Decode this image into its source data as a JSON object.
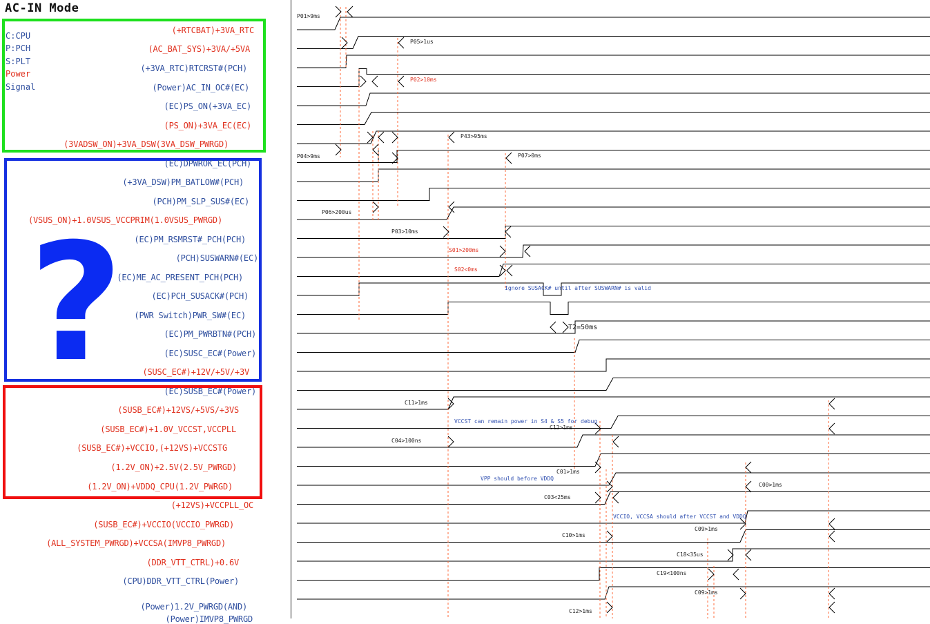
{
  "title": "AC-IN Mode",
  "legend": [
    {
      "text": "C:CPU",
      "kind": "signal"
    },
    {
      "text": "P:PCH",
      "kind": "signal"
    },
    {
      "text": "S:PLT",
      "kind": "signal"
    },
    {
      "text": "Power",
      "kind": "power"
    },
    {
      "text": "Signal",
      "kind": "signal"
    }
  ],
  "colors": {
    "signal": "#2f4f9f",
    "power": "#e0301e",
    "green_box": "#1ee01e",
    "blue_box": "#1530e0",
    "red_box": "#f01010",
    "question": "#0b2bf2",
    "timing_line": "#000000",
    "guide": "#ff6a3a"
  },
  "question_mark": "?",
  "signals": [
    {
      "label": "(+RTCBAT)+3VA_RTC",
      "kind": "power"
    },
    {
      "label": "(AC_BAT_SYS)+3VA/+5VA",
      "kind": "power"
    },
    {
      "label": "(+3VA_RTC)RTCRST#(PCH)",
      "kind": "signal"
    },
    {
      "label": "(Power)AC_IN_OC#(EC)",
      "kind": "signal"
    },
    {
      "label": "(EC)PS_ON(+3VA_EC)",
      "kind": "signal"
    },
    {
      "label": "(PS_ON)+3VA_EC(EC)",
      "kind": "power"
    },
    {
      "label": "(3VADSW_ON)+3VA_DSW(3VA_DSW_PWRGD)",
      "kind": "power"
    },
    {
      "label": "(EC)DPWROK_EC(PCH)",
      "kind": "signal"
    },
    {
      "label": "(+3VA_DSW)PM_BATLOW#(PCH)",
      "kind": "signal"
    },
    {
      "label": "(PCH)PM_SLP_SUS#(EC)",
      "kind": "signal"
    },
    {
      "label": "(VSUS_ON)+1.0VSUS_VCCPRIM(1.0VSUS_PWRGD)",
      "kind": "power"
    },
    {
      "label": "(EC)PM_RSMRST#_PCH(PCH)",
      "kind": "signal"
    },
    {
      "label": "(PCH)SUSWARN#(EC)",
      "kind": "signal"
    },
    {
      "label": "(EC)ME_AC_PRESENT_PCH(PCH)",
      "kind": "signal"
    },
    {
      "label": "(EC)PCH_SUSACK#(PCH)",
      "kind": "signal"
    },
    {
      "label": "(PWR Switch)PWR_SW#(EC)",
      "kind": "signal"
    },
    {
      "label": "(EC)PM_PWRBTN#(PCH)",
      "kind": "signal"
    },
    {
      "label": "(EC)SUSC_EC#(Power)",
      "kind": "signal"
    },
    {
      "label": "(SUSC_EC#)+12V/+5V/+3V",
      "kind": "power"
    },
    {
      "label": "(EC)SUSB_EC#(Power)",
      "kind": "signal"
    },
    {
      "label": "(SUSB_EC#)+12VS/+5VS/+3VS",
      "kind": "power"
    },
    {
      "label": "(SUSB_EC#)+1.0V_VCCST,VCCPLL",
      "kind": "power"
    },
    {
      "label": "(SUSB_EC#)+VCCIO,(+12VS)+VCCSTG",
      "kind": "power"
    },
    {
      "label": "(1.2V_ON)+2.5V(2.5V_PWRGD)",
      "kind": "power"
    },
    {
      "label": "(1.2V_ON)+VDDQ_CPU(1.2V_PWRGD)",
      "kind": "power"
    },
    {
      "label": "(+12VS)+VCCPLL_OC",
      "kind": "power"
    },
    {
      "label": "(SUSB_EC#)+VCCIO(VCCIO_PWRGD)",
      "kind": "power"
    },
    {
      "label": "(ALL_SYSTEM_PWRGD)+VCCSA(IMVP8_PWRGD)",
      "kind": "power"
    },
    {
      "label": "(DDR_VTT_CTRL)+0.6V",
      "kind": "power"
    },
    {
      "label": "(CPU)DDR_VTT_CTRL(Power)",
      "kind": "signal"
    },
    {
      "label": "(Power)1.2V_PWRGD(AND)",
      "kind": "signal"
    },
    {
      "label": "(Power)IMVP8_PWRGD",
      "kind": "signal"
    }
  ],
  "annotations": [
    {
      "text": "P01>9ms",
      "kind": "signal"
    },
    {
      "text": "P05>1us",
      "kind": "signal"
    },
    {
      "text": "P02>10ms",
      "kind": "power"
    },
    {
      "text": "P43>95ms",
      "kind": "signal"
    },
    {
      "text": "P04>9ms",
      "kind": "signal"
    },
    {
      "text": "P07>0ms",
      "kind": "signal"
    },
    {
      "text": "P06>200us",
      "kind": "signal"
    },
    {
      "text": "P03>10ms",
      "kind": "signal"
    },
    {
      "text": "S01>200ms",
      "kind": "power"
    },
    {
      "text": "S02<0ms",
      "kind": "power"
    },
    {
      "text": "Ignore SUSACK# until after SUSWARN# is valid",
      "kind": "blue"
    },
    {
      "text": "T2=50ms",
      "kind": "signal"
    },
    {
      "text": "C11>1ms",
      "kind": "signal"
    },
    {
      "text": "VCCST can remain power in S4 & S5 for debug",
      "kind": "blue"
    },
    {
      "text": "C12>1ms",
      "kind": "signal"
    },
    {
      "text": "C04>100ns",
      "kind": "signal"
    },
    {
      "text": "C01>1ms",
      "kind": "signal"
    },
    {
      "text": "VPP should before VDDQ",
      "kind": "blue"
    },
    {
      "text": "C00>1ms",
      "kind": "signal"
    },
    {
      "text": "C03<25ms",
      "kind": "signal"
    },
    {
      "text": "VCCIO, VCCSA should after VCCST and VDDQ",
      "kind": "blue"
    },
    {
      "text": "C09>1ms",
      "kind": "signal"
    },
    {
      "text": "C10>1ms",
      "kind": "signal"
    },
    {
      "text": "C18<35us",
      "kind": "signal"
    },
    {
      "text": "C19<100ns",
      "kind": "signal"
    },
    {
      "text": "C09>1ms",
      "kind": "signal"
    },
    {
      "text": "C12>1ms",
      "kind": "signal"
    }
  ]
}
